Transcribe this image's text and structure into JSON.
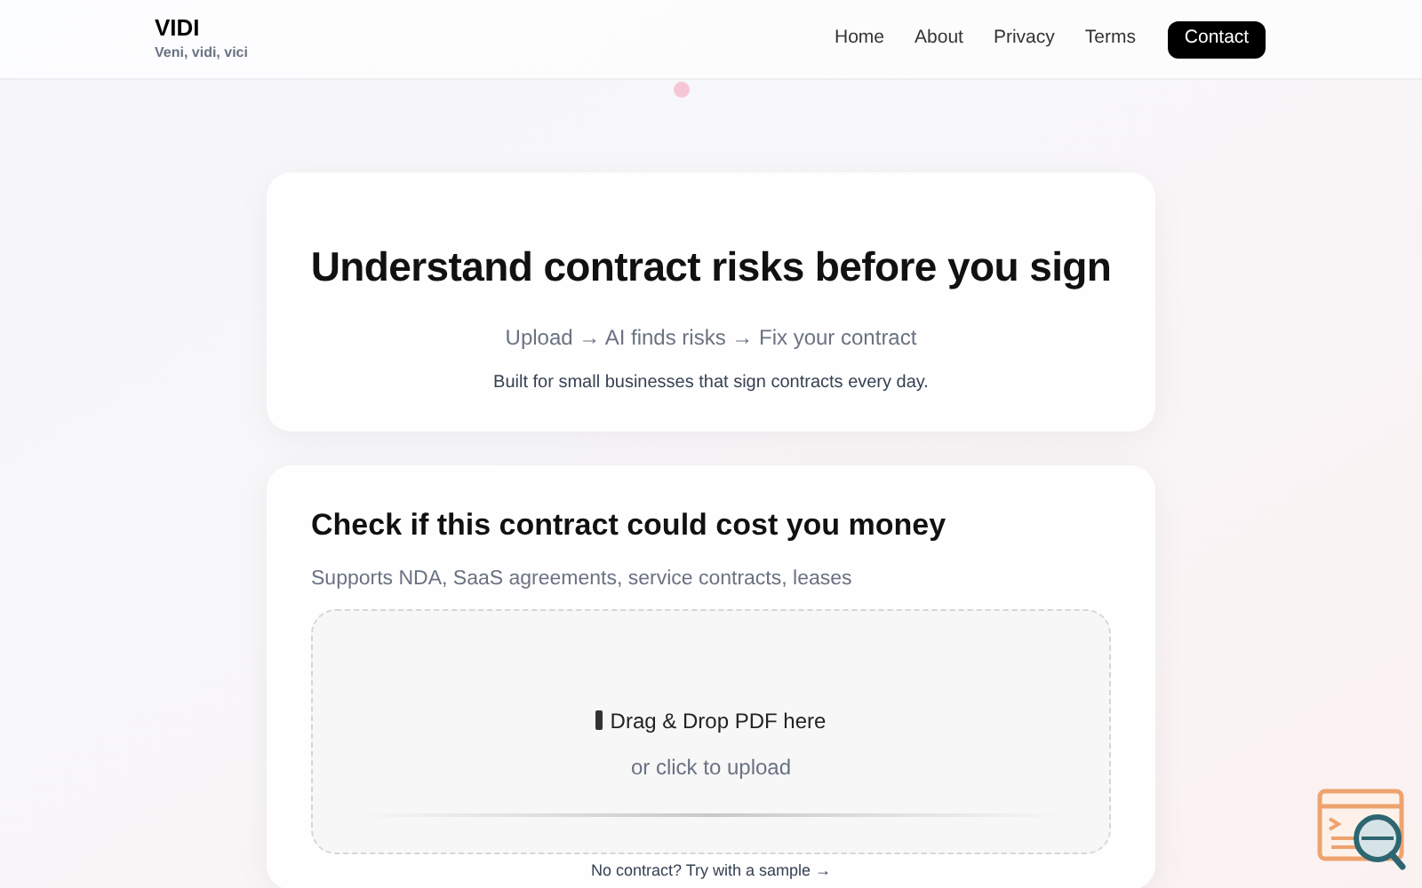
{
  "header": {
    "brand": "VIDI",
    "tagline": "Veni, vidi, vici",
    "nav": [
      {
        "label": "Home"
      },
      {
        "label": "About"
      },
      {
        "label": "Privacy"
      },
      {
        "label": "Terms"
      }
    ],
    "cta": "Contact"
  },
  "hero": {
    "title": "Understand contract risks before you sign",
    "steps": "Upload → AI finds risks → Fix your contract",
    "note": "Built for small businesses that sign contracts every day."
  },
  "upload": {
    "title": "Check if this contract could cost you money",
    "subtitle": "Supports NDA, SaaS agreements, service contracts, leases",
    "dropzone": {
      "prompt": "Drag & Drop PDF here",
      "hint": "or click to upload"
    },
    "sample_link": "No contract? Try with a sample →"
  }
}
